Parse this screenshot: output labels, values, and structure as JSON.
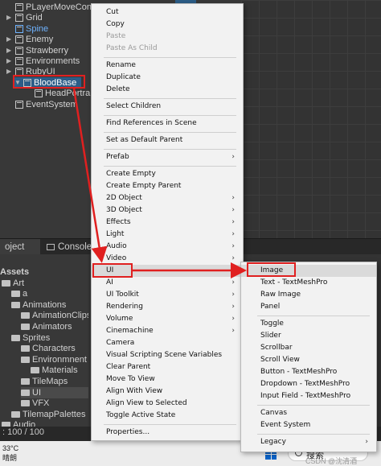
{
  "hierarchy": {
    "items": [
      {
        "label": "PLayerMoveConfi",
        "indent": 0,
        "has_arrow": false
      },
      {
        "label": "Grid",
        "indent": 0,
        "has_arrow": true
      },
      {
        "label": "Spine",
        "indent": 0,
        "has_arrow": false,
        "color": "#6fb3ff"
      },
      {
        "label": "Enemy",
        "indent": 0,
        "has_arrow": true
      },
      {
        "label": "Strawberry",
        "indent": 0,
        "has_arrow": true
      },
      {
        "label": "Environments",
        "indent": 0,
        "has_arrow": true
      },
      {
        "label": "RubyUI",
        "indent": 0,
        "has_arrow": true
      },
      {
        "label": "BloodBase",
        "indent": 1,
        "has_arrow": true,
        "selected": true
      },
      {
        "label": "HeadPortra",
        "indent": 2,
        "has_arrow": false
      },
      {
        "label": "EventSystem",
        "indent": 0,
        "has_arrow": false
      }
    ]
  },
  "tabs": {
    "project": "oject",
    "console": "Console"
  },
  "project": {
    "items": [
      {
        "label": "Assets",
        "indent": 0,
        "bold": true
      },
      {
        "label": "Art",
        "indent": 0
      },
      {
        "label": "a",
        "indent": 1
      },
      {
        "label": "Animations",
        "indent": 1
      },
      {
        "label": "AnimationClips",
        "indent": 2
      },
      {
        "label": "Animators",
        "indent": 2
      },
      {
        "label": "Sprites",
        "indent": 1
      },
      {
        "label": "Characters",
        "indent": 2
      },
      {
        "label": "Environmnent",
        "indent": 2
      },
      {
        "label": "Materials",
        "indent": 3
      },
      {
        "label": "TileMaps",
        "indent": 2
      },
      {
        "label": "UI",
        "indent": 2,
        "selected": true
      },
      {
        "label": "VFX",
        "indent": 2
      },
      {
        "label": "TilemapPalettes",
        "indent": 1
      },
      {
        "label": "Audio",
        "indent": 0
      }
    ]
  },
  "status": {
    "text": ": 100 / 100"
  },
  "taskbar": {
    "temperature": "33°C",
    "weather": "晴朗",
    "search_label": "搜索",
    "watermark": "CSDN @沈清酒"
  },
  "context_menu": {
    "items": [
      {
        "label": "Cut",
        "enabled": true
      },
      {
        "label": "Copy",
        "enabled": true
      },
      {
        "label": "Paste",
        "enabled": false
      },
      {
        "label": "Paste As Child",
        "enabled": false
      },
      {
        "sep": true
      },
      {
        "label": "Rename",
        "enabled": true
      },
      {
        "label": "Duplicate",
        "enabled": true
      },
      {
        "label": "Delete",
        "enabled": true
      },
      {
        "sep": true
      },
      {
        "label": "Select Children",
        "enabled": true
      },
      {
        "sep": true
      },
      {
        "label": "Find References in Scene",
        "enabled": true
      },
      {
        "sep": true
      },
      {
        "label": "Set as Default Parent",
        "enabled": true
      },
      {
        "sep": true
      },
      {
        "label": "Prefab",
        "enabled": true,
        "submenu": true
      },
      {
        "sep": true
      },
      {
        "label": "Create Empty",
        "enabled": true
      },
      {
        "label": "Create Empty Parent",
        "enabled": true
      },
      {
        "label": "2D Object",
        "enabled": true,
        "submenu": true
      },
      {
        "label": "3D Object",
        "enabled": true,
        "submenu": true
      },
      {
        "label": "Effects",
        "enabled": true,
        "submenu": true
      },
      {
        "label": "Light",
        "enabled": true,
        "submenu": true
      },
      {
        "label": "Audio",
        "enabled": true,
        "submenu": true
      },
      {
        "label": "Video",
        "enabled": true,
        "submenu": true
      },
      {
        "label": "UI",
        "enabled": true,
        "submenu": true,
        "highlight": true
      },
      {
        "label": "AI",
        "enabled": true,
        "submenu": true
      },
      {
        "label": "UI Toolkit",
        "enabled": true,
        "submenu": true
      },
      {
        "label": "Rendering",
        "enabled": true,
        "submenu": true
      },
      {
        "label": "Volume",
        "enabled": true,
        "submenu": true
      },
      {
        "label": "Cinemachine",
        "enabled": true,
        "submenu": true
      },
      {
        "label": "Camera",
        "enabled": true
      },
      {
        "label": "Visual Scripting Scene Variables",
        "enabled": true
      },
      {
        "label": "Clear Parent",
        "enabled": true
      },
      {
        "label": "Move To View",
        "enabled": true
      },
      {
        "label": "Align With View",
        "enabled": true
      },
      {
        "label": "Align View to Selected",
        "enabled": true
      },
      {
        "label": "Toggle Active State",
        "enabled": true
      },
      {
        "sep": true
      },
      {
        "label": "Properties...",
        "enabled": true
      }
    ]
  },
  "ui_submenu": {
    "items": [
      {
        "label": "Image",
        "highlight": true
      },
      {
        "label": "Text - TextMeshPro"
      },
      {
        "label": "Raw Image"
      },
      {
        "label": "Panel"
      },
      {
        "sep": true
      },
      {
        "label": "Toggle"
      },
      {
        "label": "Slider"
      },
      {
        "label": "Scrollbar"
      },
      {
        "label": "Scroll View"
      },
      {
        "label": "Button - TextMeshPro"
      },
      {
        "label": "Dropdown - TextMeshPro"
      },
      {
        "label": "Input Field - TextMeshPro"
      },
      {
        "sep": true
      },
      {
        "label": "Canvas"
      },
      {
        "label": "Event System"
      },
      {
        "sep": true
      },
      {
        "label": "Legacy",
        "submenu": true
      }
    ]
  },
  "colors": {
    "annotation_red": "#e02020",
    "selection_blue": "#2c5d87",
    "menu_bg": "#f2f2f2"
  }
}
